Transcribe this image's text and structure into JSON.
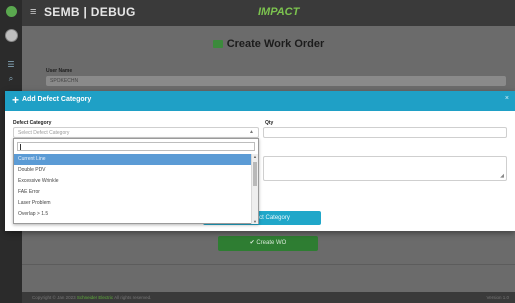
{
  "app": {
    "brand": "SEMB | DEBUG",
    "logo_text": "IMPACT",
    "menu_icon": "≡"
  },
  "page": {
    "title": "Create Work Order",
    "user_name_label": "User Name",
    "user_name_value": "SPOKECHN",
    "create_wo_label": "✔ Create WO"
  },
  "modal": {
    "title": "Add Defect Category",
    "plus_icon": "+",
    "close_icon": "×",
    "defect_category_label": "Defect Category",
    "defect_category_placeholder": "Select Defect Category",
    "qty_label": "Qty",
    "add_button_label": "Add Defect Category"
  },
  "dropdown": {
    "selected_index": 0,
    "options": [
      "Current Line",
      "Double PDV",
      "Excessive Wrinkle",
      "FAE Error",
      "Laser Problem",
      "Overlap > 1.5"
    ]
  },
  "footer": {
    "prefix": "Copyright © Jan 2023",
    "company": "Schneider Electric",
    "suffix": " All rights reserved.",
    "version": "Version 1.0"
  },
  "colors": {
    "accent": "#1fa0c6",
    "brand_green": "#7cc34f",
    "button_green": "#2e7d32",
    "selected_option": "#5b9bd5"
  }
}
